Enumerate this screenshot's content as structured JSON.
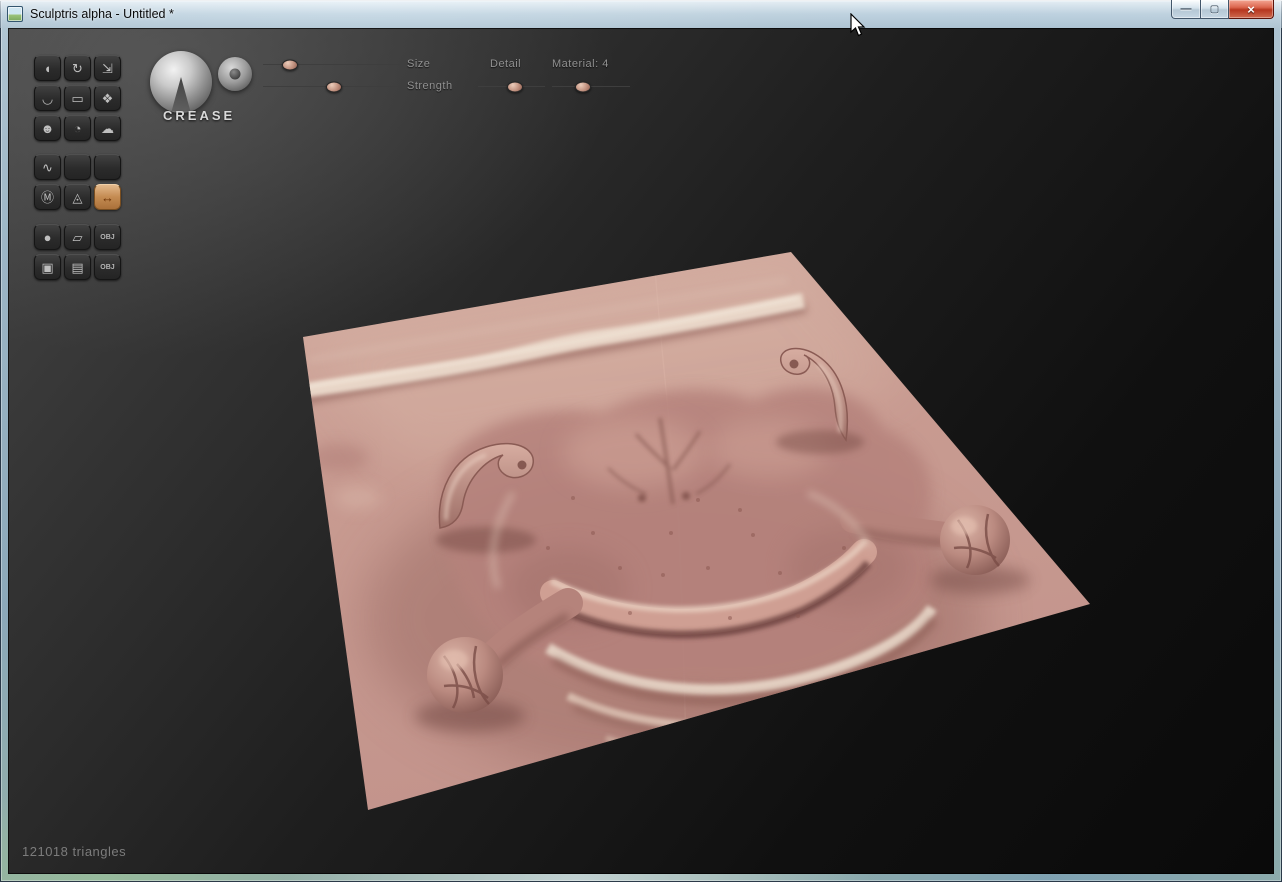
{
  "window": {
    "title": "Sculptris alpha - Untitled *",
    "controls": [
      {
        "name": "minimize",
        "glyph": "—"
      },
      {
        "name": "maximize",
        "glyph": "▢"
      },
      {
        "name": "close",
        "glyph": "×"
      }
    ]
  },
  "toolbar": {
    "tools": [
      {
        "name": "draw",
        "glyph": "◖"
      },
      {
        "name": "rotate",
        "glyph": "↻"
      },
      {
        "name": "scale",
        "glyph": "⇲"
      },
      {
        "name": "crease",
        "glyph": "◡"
      },
      {
        "name": "flatten",
        "glyph": "▭"
      },
      {
        "name": "grab",
        "glyph": "❖"
      },
      {
        "name": "inflate",
        "glyph": "☻"
      },
      {
        "name": "pinch",
        "glyph": "◔"
      },
      {
        "name": "smooth",
        "glyph": "☁"
      },
      {
        "name": "reduce-brush",
        "glyph": "∿"
      },
      {
        "name": "option-a",
        "glyph": ""
      },
      {
        "name": "option-b",
        "glyph": ""
      },
      {
        "name": "mask",
        "glyph": "Ⓜ"
      },
      {
        "name": "wireframe",
        "glyph": "◬"
      },
      {
        "name": "symmetry",
        "glyph": "↔",
        "active": true
      },
      {
        "name": "new-sphere",
        "glyph": "●"
      },
      {
        "name": "new-plane",
        "glyph": "▱"
      },
      {
        "name": "import-obj",
        "glyph": "OBJ"
      },
      {
        "name": "save",
        "glyph": "▣"
      },
      {
        "name": "open",
        "glyph": "▤"
      },
      {
        "name": "export-obj",
        "glyph": "OBJ"
      }
    ]
  },
  "brush_panel": {
    "active_brush": "CREASE",
    "sliders": {
      "size": {
        "label": "Size",
        "value_pct": 20
      },
      "strength": {
        "label": "Strength",
        "value_pct": 52
      },
      "detail": {
        "label": "Detail",
        "value_pct": 55
      },
      "material": {
        "label": "Material: 4",
        "value_pct": 40
      }
    }
  },
  "status_bar": {
    "triangle_count": "121018 triangles"
  },
  "theme": {
    "canvas_top": "#474747",
    "canvas_bottom": "#0a0a0a",
    "clay_color": "#c79a90",
    "active_tool_color": "#c48b52"
  }
}
